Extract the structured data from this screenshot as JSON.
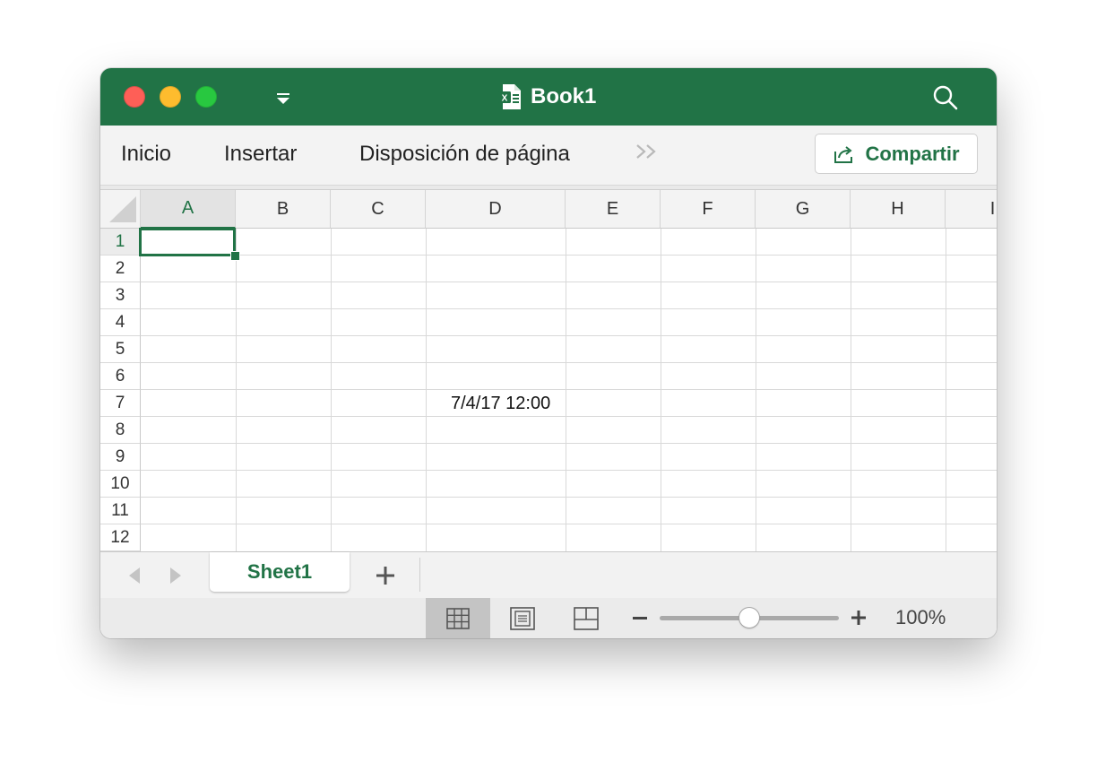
{
  "app": {
    "document_title": "Book1",
    "accent_color": "#217346"
  },
  "ribbon": {
    "tabs": [
      "Inicio",
      "Insertar",
      "Disposición de página"
    ],
    "share_label": "Compartir"
  },
  "sheet": {
    "columns": [
      "A",
      "B",
      "C",
      "D",
      "E",
      "F",
      "G",
      "H",
      "I"
    ],
    "rows": [
      "1",
      "2",
      "3",
      "4",
      "5",
      "6",
      "7",
      "8",
      "9",
      "10",
      "11",
      "12"
    ],
    "active_cell": "A1",
    "cells": [
      {
        "ref": "D7",
        "value": "7/4/17 12:00"
      }
    ]
  },
  "sheet_tabs": {
    "tabs": [
      "Sheet1"
    ],
    "active": "Sheet1"
  },
  "status_bar": {
    "active_view": "normal",
    "zoom_label": "100%",
    "zoom_slider_fraction": 0.5
  }
}
